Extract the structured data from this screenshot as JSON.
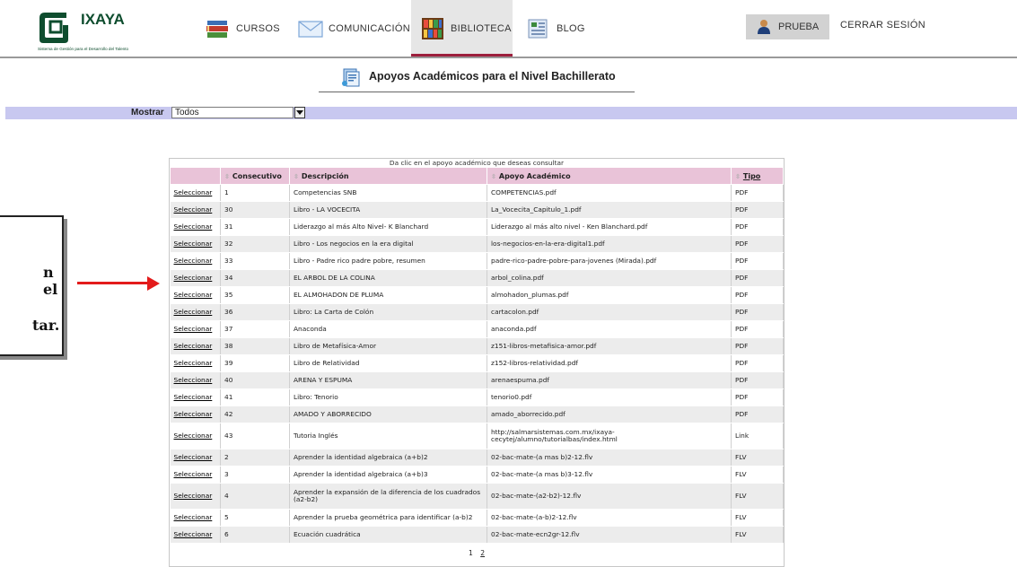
{
  "header": {
    "logo_name": "IXAYA",
    "logo_tagline": "Sistema de Gestión para el Desarrollo del Talento",
    "nav": [
      {
        "label": "CURSOS",
        "icon": "books-icon"
      },
      {
        "label": "COMUNICACIÓN",
        "icon": "envelope-icon"
      },
      {
        "label": "BIBLIOTECA",
        "icon": "library-icon"
      },
      {
        "label": "BLOG",
        "icon": "blog-icon"
      }
    ],
    "active_nav": "BIBLIOTECA",
    "user_label": "PRUEBA",
    "logout_label": "CERRAR SESIÓN",
    "accent_color": "#9d1f3d"
  },
  "page": {
    "title": "Apoyos Académicos para el Nivel Bachillerato"
  },
  "filter": {
    "label": "Mostrar",
    "selected": "Todos"
  },
  "callout": {
    "line1": "n el",
    "line2": "tar."
  },
  "table": {
    "caption": "Da clic en el apoyo académico que deseas consultar",
    "headers": [
      "",
      "Consecutivo",
      "Descripción",
      "Apoyo Académico",
      "Tipo"
    ],
    "select_label": "Seleccionar",
    "rows": [
      {
        "num": "1",
        "desc": "Competencias SNB",
        "file": "COMPETENCIAS.pdf",
        "type": "PDF"
      },
      {
        "num": "30",
        "desc": "Libro - LA VOCECITA",
        "file": "La_Vocecita_Capitulo_1.pdf",
        "type": "PDF"
      },
      {
        "num": "31",
        "desc": "Liderazgo al más Alto Nivel- K Blanchard",
        "file": "Liderazgo al más alto nivel - Ken Blanchard.pdf",
        "type": "PDF"
      },
      {
        "num": "32",
        "desc": "Libro - Los negocios en la era digital",
        "file": "los-negocios-en-la-era-digital1.pdf",
        "type": "PDF"
      },
      {
        "num": "33",
        "desc": "Libro - Padre rico padre pobre, resumen",
        "file": "padre-rico-padre-pobre-para-jovenes (Mirada).pdf",
        "type": "PDF"
      },
      {
        "num": "34",
        "desc": "EL ARBOL DE LA COLINA",
        "file": "arbol_colina.pdf",
        "type": "PDF"
      },
      {
        "num": "35",
        "desc": "EL ALMOHADON DE PLUMA",
        "file": "almohadon_plumas.pdf",
        "type": "PDF"
      },
      {
        "num": "36",
        "desc": "Libro: La Carta de Colón",
        "file": "cartacolon.pdf",
        "type": "PDF"
      },
      {
        "num": "37",
        "desc": "Anaconda",
        "file": "anaconda.pdf",
        "type": "PDF"
      },
      {
        "num": "38",
        "desc": "Libro de Metafísica-Amor",
        "file": "z151-libros-metafisica-amor.pdf",
        "type": "PDF"
      },
      {
        "num": "39",
        "desc": "Libro de Relatividad",
        "file": "z152-libros-relatividad.pdf",
        "type": "PDF"
      },
      {
        "num": "40",
        "desc": "ARENA Y ESPUMA",
        "file": "arenaespuma.pdf",
        "type": "PDF"
      },
      {
        "num": "41",
        "desc": "Libro: Tenorio",
        "file": "tenorio0.pdf",
        "type": "PDF"
      },
      {
        "num": "42",
        "desc": "AMADO Y ABORRECIDO",
        "file": "amado_aborrecido.pdf",
        "type": "PDF"
      },
      {
        "num": "43",
        "desc": "Tutoria Inglés",
        "file": "http://salmarsistemas.com.mx/ixaya-cecytej/alumno/tutorialbas/index.html",
        "type": "Link",
        "tall": true
      },
      {
        "num": "2",
        "desc": "Aprender la identidad algebraica (a+b)2",
        "file": "02-bac-mate-(a mas b)2-12.flv",
        "type": "FLV"
      },
      {
        "num": "3",
        "desc": "Aprender la identidad algebraica (a+b)3",
        "file": "02-bac-mate-(a mas b)3-12.flv",
        "type": "FLV"
      },
      {
        "num": "4",
        "desc": "Aprender la expansión de la diferencia de los cuadrados (a2-b2)",
        "file": "02-bac-mate-(a2-b2)-12.flv",
        "type": "FLV",
        "tall": true
      },
      {
        "num": "5",
        "desc": "Aprender la prueba geométrica para identificar (a-b)2",
        "file": "02-bac-mate-(a-b)2-12.flv",
        "type": "FLV"
      },
      {
        "num": "6",
        "desc": "Ecuación cuadrática",
        "file": "02-bac-mate-ecn2gr-12.flv",
        "type": "FLV"
      }
    ]
  },
  "pager": {
    "pages": [
      "1",
      "2"
    ],
    "current": "1"
  },
  "colors": {
    "header_row": "#e9c3d8",
    "filter_bar": "#c8c8f0",
    "arrow": "#e31b1b"
  }
}
